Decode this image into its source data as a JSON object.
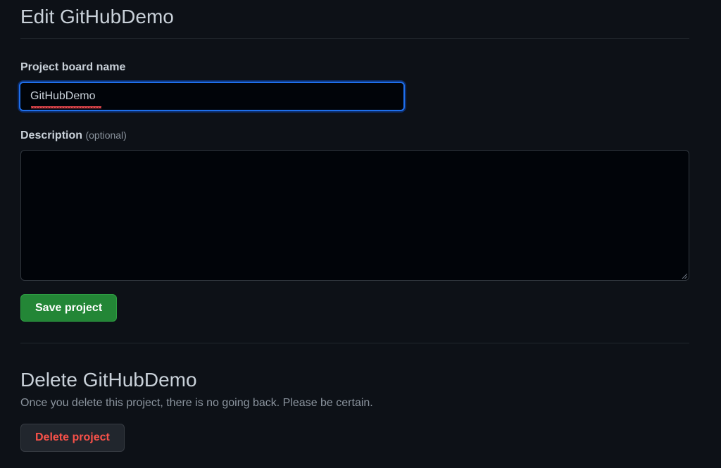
{
  "edit": {
    "title": "Edit GitHubDemo",
    "name_label": "Project board name",
    "name_value": "GitHubDemo",
    "description_label": "Description",
    "description_optional": "(optional)",
    "description_value": "",
    "save_label": "Save project",
    "accent_color": "#1f6feb",
    "save_color": "#238636"
  },
  "delete": {
    "title": "Delete GitHubDemo",
    "note": "Once you delete this project, there is no going back. Please be certain.",
    "button_label": "Delete project",
    "danger_color": "#f85149"
  },
  "icons": {
    "textarea_resize": "resize-grip-icon"
  }
}
